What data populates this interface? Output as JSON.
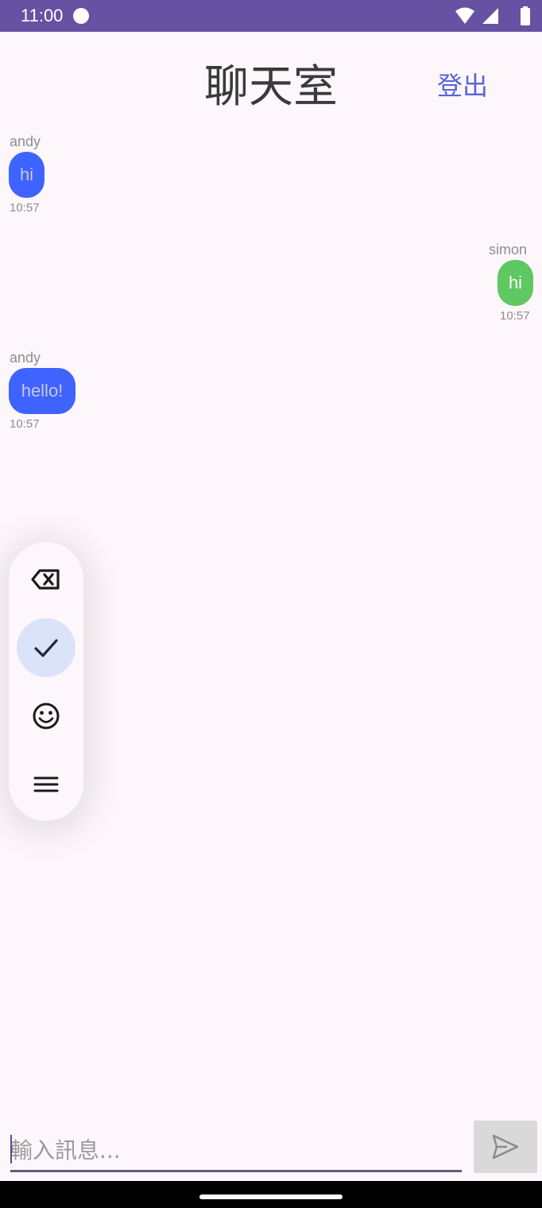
{
  "status_bar": {
    "time": "11:00",
    "icons": [
      "dot-indicator-icon",
      "wifi-icon",
      "cell-signal-icon",
      "battery-icon"
    ]
  },
  "header": {
    "title": "聊天室",
    "logout_label": "登出"
  },
  "messages": [
    {
      "sender": "andy",
      "text": "hi",
      "time": "10:57",
      "side": "left",
      "color": "#3f63ff"
    },
    {
      "sender": "simon",
      "text": "hi",
      "time": "10:57",
      "side": "right",
      "color": "#5fc861"
    },
    {
      "sender": "andy",
      "text": "hello!",
      "time": "10:57",
      "side": "left",
      "color": "#3f63ff"
    }
  ],
  "keyboard_toolbar": {
    "buttons": [
      "backspace-icon",
      "checkmark-icon",
      "emoji-icon",
      "menu-icon"
    ],
    "selected": "checkmark-icon"
  },
  "composer": {
    "placeholder": "輸入訊息...",
    "value": "",
    "send_icon": "send-icon"
  },
  "colors": {
    "status_bar": "#6751a2",
    "accent": "#5b63d8",
    "my_bubble": "#3f63ff",
    "other_bubble": "#5fc861",
    "background": "#fdf7fc"
  }
}
